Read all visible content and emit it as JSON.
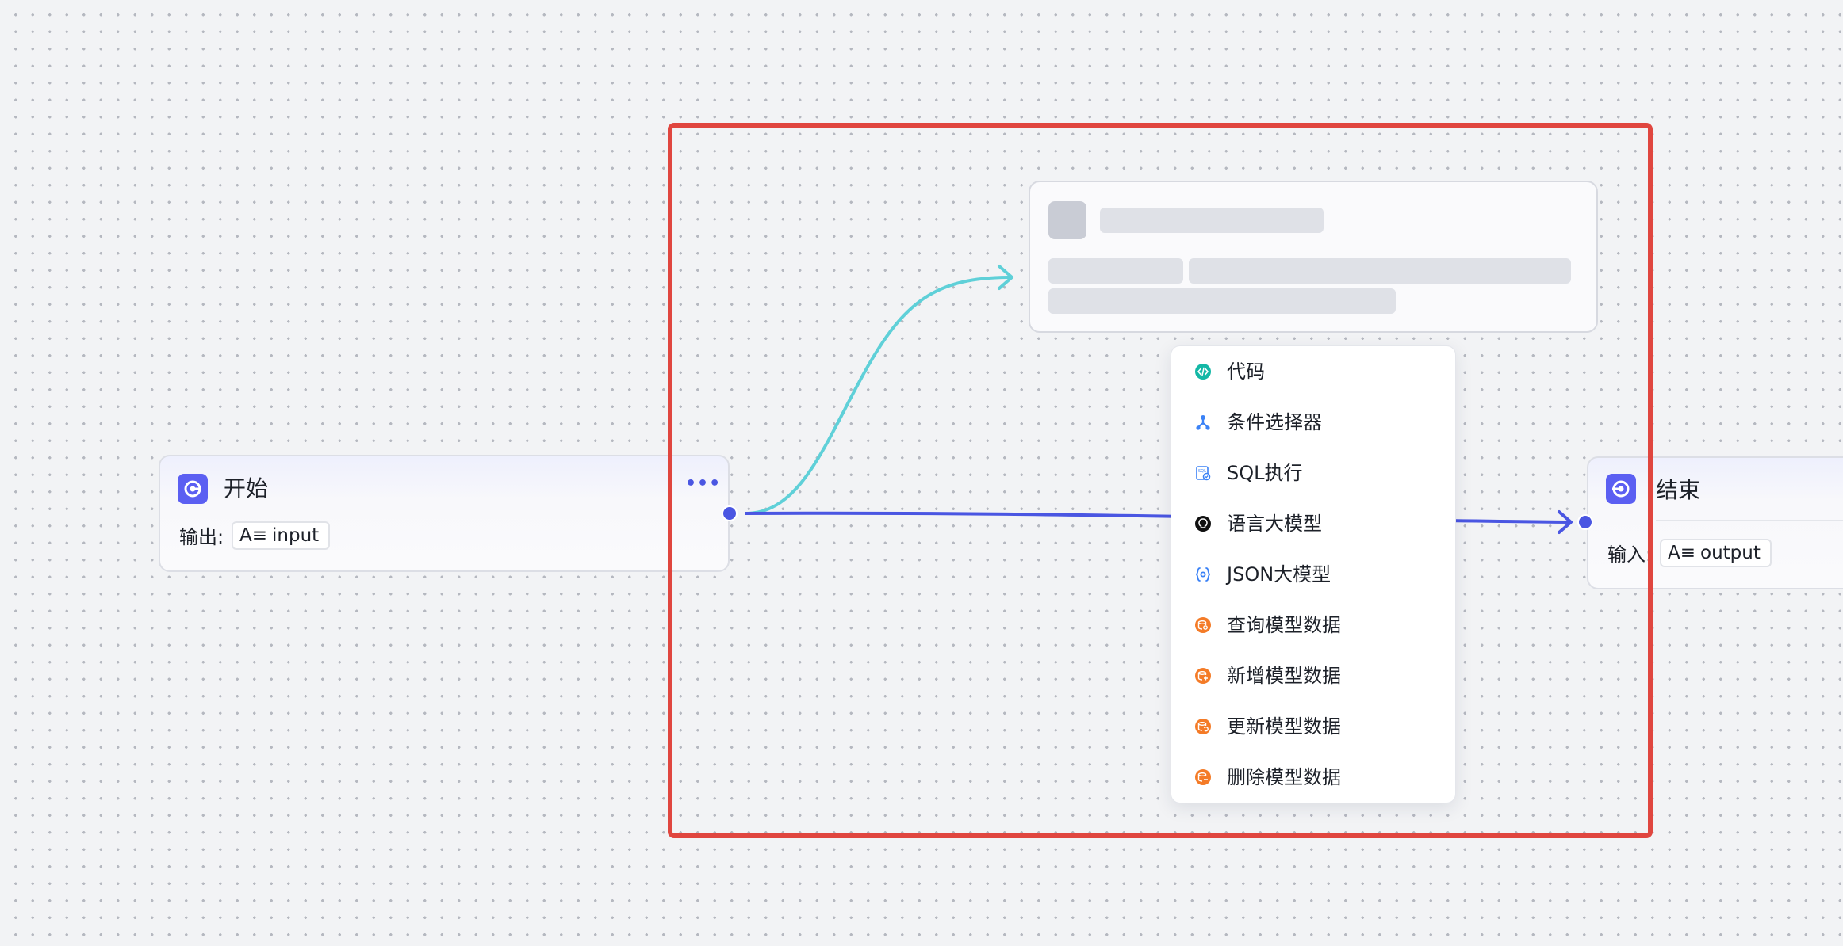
{
  "start_node": {
    "title": "开始",
    "io_label": "输出:",
    "variable": "input",
    "more_label": "•••"
  },
  "end_node": {
    "title": "结束",
    "io_label": "输入:",
    "variable": "output"
  },
  "node_menu": {
    "items": [
      {
        "label": "代码",
        "icon": "code-icon"
      },
      {
        "label": "条件选择器",
        "icon": "condition-icon"
      },
      {
        "label": "SQL执行",
        "icon": "sql-icon"
      },
      {
        "label": "语言大模型",
        "icon": "llm-icon"
      },
      {
        "label": "JSON大模型",
        "icon": "json-icon"
      },
      {
        "label": "查询模型数据",
        "icon": "database-query-icon"
      },
      {
        "label": "新增模型数据",
        "icon": "database-add-icon"
      },
      {
        "label": "更新模型数据",
        "icon": "database-update-icon"
      },
      {
        "label": "删除模型数据",
        "icon": "database-delete-icon"
      }
    ]
  },
  "colors": {
    "canvas_bg": "#f2f3f5",
    "accent": "#5b5ff2",
    "edge_main": "#4a56e2",
    "edge_pending": "#5fd0d8",
    "selection": "#e0463f",
    "code_icon": "#14b8a6",
    "condition_icon": "#3b82f6",
    "json_icon": "#3b82f6",
    "database_icon": "#f47b27"
  }
}
